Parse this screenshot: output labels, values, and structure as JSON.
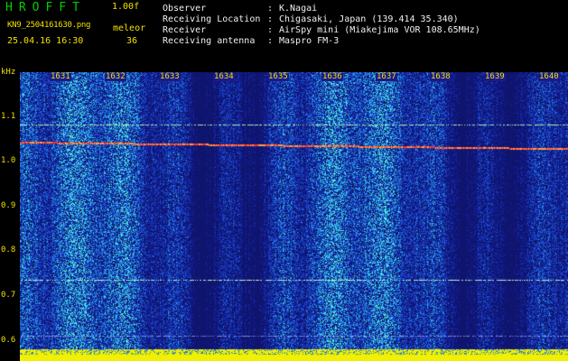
{
  "header": {
    "app_title": "HROFFT",
    "version": "1.00f",
    "filename": "KN9_2504161630.png",
    "mode": "meleor",
    "datetime": "25.04.16 16:30",
    "count": "36"
  },
  "info": [
    {
      "label": "Observer",
      "sep": ":",
      "value": "K.Nagai"
    },
    {
      "label": "Receiving Location",
      "sep": ":",
      "value": "Chigasaki, Japan (139.414 35.340)"
    },
    {
      "label": "Receiver",
      "sep": ":",
      "value": "AirSpy mini (Miakejima VOR 108.65MHz)"
    },
    {
      "label": "Receiving antenna",
      "sep": ":",
      "value": "Maspro FM-3"
    }
  ],
  "spectrogram": {
    "y_unit": "kHz",
    "y_ticks": [
      "1.1",
      "1.0",
      "0.9",
      "0.8",
      "0.7",
      "0.6"
    ],
    "x_ticks": [
      "1631",
      "1632",
      "1633",
      "1634",
      "1635",
      "1636",
      "1637",
      "1638",
      "1639",
      "1640"
    ],
    "colors": {
      "background": "#1a1a8a",
      "noise_mid": "#2060e0",
      "noise_high": "#40e0e0",
      "carrier": "#ff3030",
      "floor": "#f0f000"
    }
  }
}
